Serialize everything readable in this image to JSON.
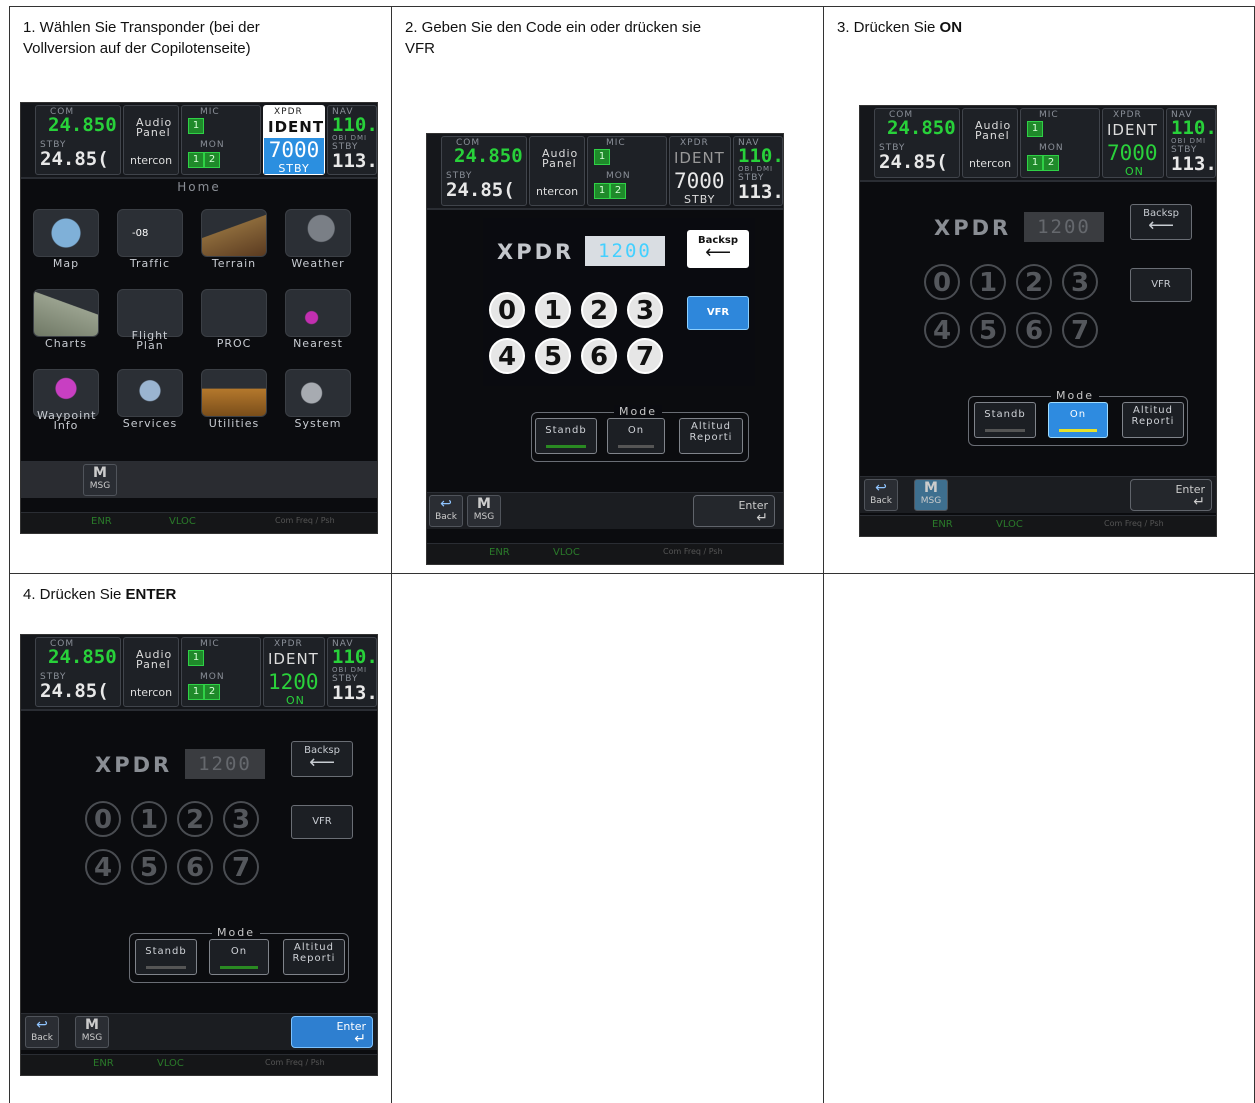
{
  "steps": [
    {
      "caption_a": "1. Wählen Sie Transponder (bei der",
      "caption_b": "Vollversion auf der Copilotenseite)"
    },
    {
      "caption_a": "2. Geben Sie den Code ein oder drücken sie",
      "caption_b": "VFR"
    },
    {
      "caption_pre": "3. Drücken Sie ",
      "caption_bold": "ON"
    },
    {
      "caption_pre": "4. Drücken Sie ",
      "caption_bold": "ENTER"
    }
  ],
  "topbar": {
    "com_label": "COM",
    "com_freq": "24.850",
    "stby_label": "STBY",
    "com_stby": "24.85(",
    "audio_label_1": "Audio",
    "audio_label_2": "Panel",
    "intercom": "ntercon",
    "mic_label": "MIC",
    "mic_value": "1",
    "mon_label": "MON",
    "mon_1": "1",
    "mon_2": "2",
    "xpdr_label": "XPDR",
    "ident_label": "IDENT",
    "code_stby": "7000",
    "mode_stby": "STBY",
    "code_on_3": "7000",
    "code_on_4": "1200",
    "mode_on": "ON",
    "nav_label": "NAV",
    "nav_freq": "110.5",
    "obs_dme": "OBI DMI",
    "nav_stby_label": "STBY",
    "nav_stby": "113.9",
    "side_com": "Co",
    "side_vol": "Vol",
    "side_psh": "Psh",
    "side_sq": "Sq"
  },
  "home": {
    "title": "Home",
    "icons": [
      "Map",
      "Traffic",
      "Terrain",
      "Weather",
      "Charts",
      "Flight Plan",
      "PROC",
      "Nearest",
      "Waypoint Info",
      "Services",
      "Utilities",
      "System"
    ],
    "traffic_value": "-08"
  },
  "keypad": {
    "xpdr": "XPDR",
    "code": "1200",
    "backsp": "Backsp",
    "vfr": "VFR",
    "keys": [
      "0",
      "1",
      "2",
      "3",
      "4",
      "5",
      "6",
      "7"
    ],
    "mode": "Mode",
    "standby": "Standb",
    "on": "On",
    "alt_1": "Altitud",
    "alt_2": "Reporti"
  },
  "soft": {
    "back": "Back",
    "msg_icon": "M",
    "msg": "MSG",
    "enter": "Enter"
  },
  "bottom": {
    "enr": "ENR",
    "vloc": "VLOC",
    "hint": "Com Freq / Psh"
  }
}
